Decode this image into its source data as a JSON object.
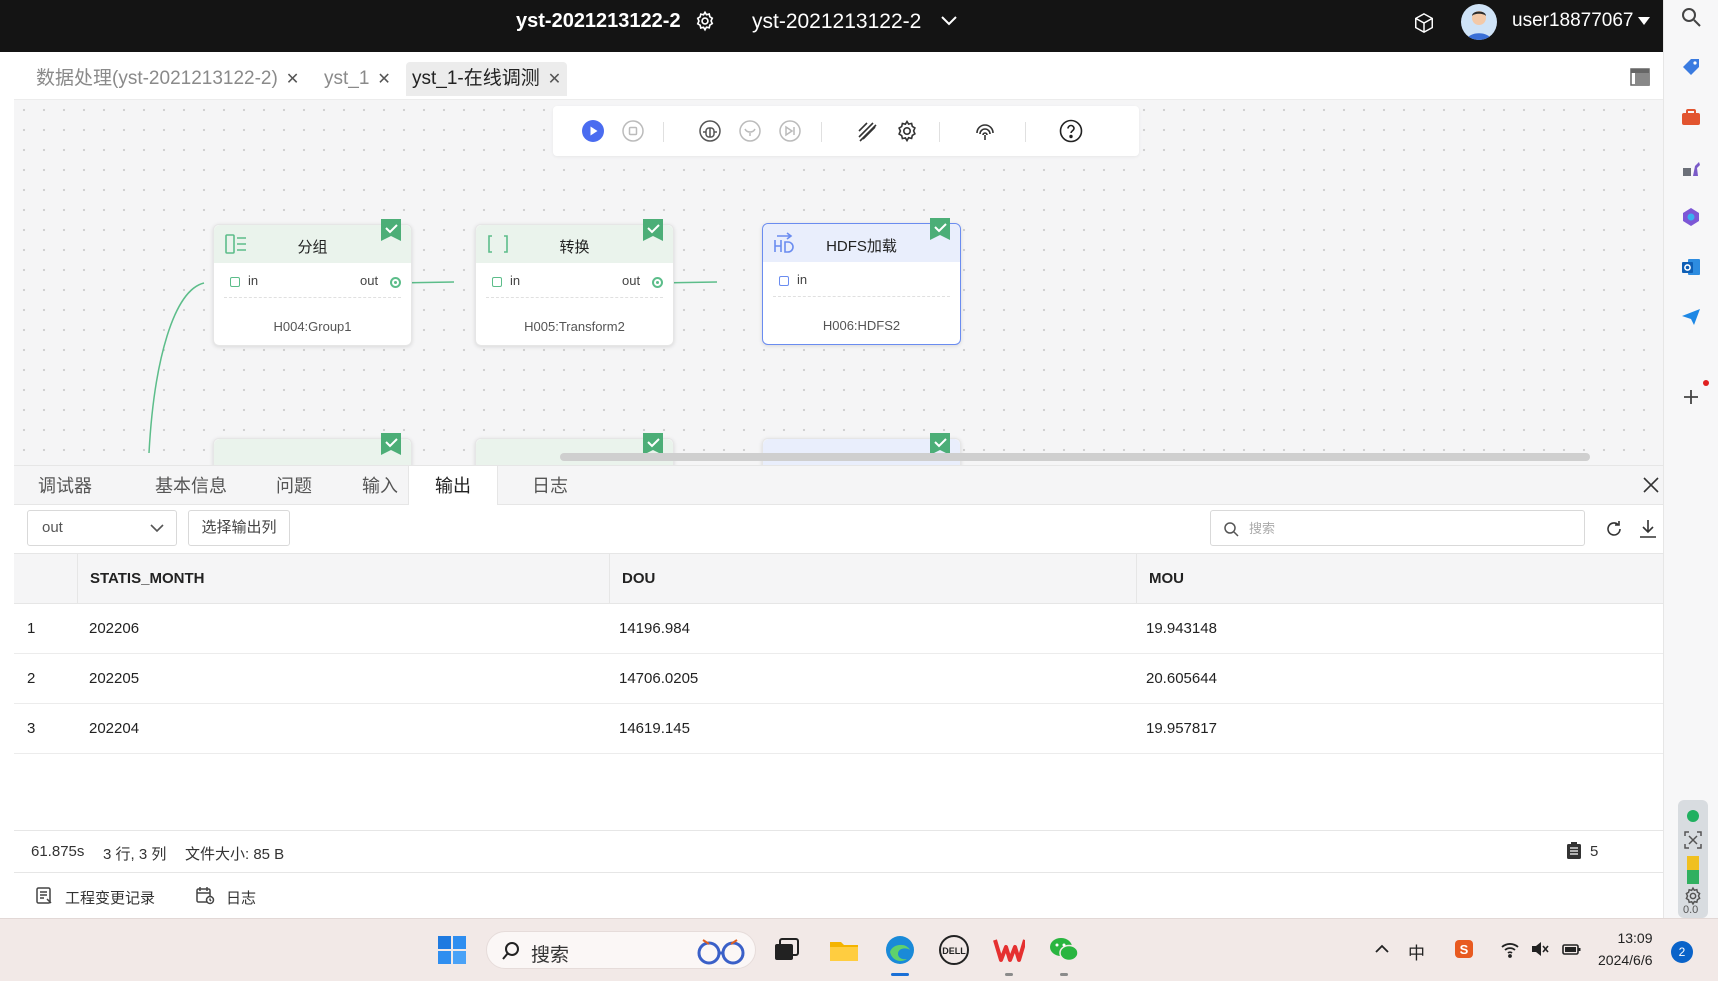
{
  "topbar": {
    "project_title": "yst-2021213122-2",
    "project_select": "yst-2021213122-2",
    "username": "user18877067"
  },
  "tabs": [
    {
      "label": "数据处理(yst-2021213122-2)",
      "active": false
    },
    {
      "label": "yst_1",
      "active": false
    },
    {
      "label": "yst_1-在线调测",
      "active": true
    }
  ],
  "toolbar": {
    "icons": [
      "run-icon",
      "stop-icon",
      "debug-icon",
      "step-icon",
      "skip-icon",
      "disable-icon",
      "settings-icon",
      "fingerprint-icon",
      "help-icon"
    ]
  },
  "nodes": [
    {
      "title": "分组",
      "in": "in",
      "out": "out",
      "label": "H004:Group1",
      "icon": "group-icon"
    },
    {
      "title": "转换",
      "in": "in",
      "out": "out",
      "label": "H005:Transform2",
      "icon": "transform-icon"
    },
    {
      "title": "HDFS加载",
      "in": "in",
      "label": "H006:HDFS2",
      "icon": "hdfs-icon"
    }
  ],
  "bottom_tabs": [
    {
      "label": "调试器",
      "active": false
    },
    {
      "label": "基本信息",
      "active": false
    },
    {
      "label": "问题",
      "active": false
    },
    {
      "label": "输入",
      "active": false
    },
    {
      "label": "输出",
      "active": true
    },
    {
      "label": "日志",
      "active": false
    }
  ],
  "filter": {
    "port_value": "out",
    "select_columns_label": "选择输出列",
    "search_placeholder": "搜索"
  },
  "table": {
    "columns": [
      "",
      "STATIS_MONTH",
      "DOU",
      "MOU"
    ],
    "rows": [
      [
        "1",
        "202206",
        "14196.984",
        "19.943148"
      ],
      [
        "2",
        "202205",
        "14706.0205",
        "20.605644"
      ],
      [
        "3",
        "202204",
        "14619.145",
        "19.957817"
      ]
    ]
  },
  "status": {
    "duration": "61.875s",
    "dims": "3 行, 3 列",
    "file_size": "文件大小: 85 B",
    "page_count": "5"
  },
  "footer": {
    "changelog_label": "工程变更记录",
    "log_label": "日志"
  },
  "taskbar": {
    "search_label": "搜索",
    "time": "13:09",
    "date": "2024/6/6",
    "notification_count": "2",
    "ime_label": "中"
  },
  "side": {
    "badge_value": "0.0"
  },
  "colors": {
    "topbar_bg": "#141414",
    "node_header_green": "#eaf3ec",
    "port_green": "#5cbd8a",
    "selected_blue": "#6a8cf0",
    "toolbar_run_blue": "#4a6cf0"
  }
}
